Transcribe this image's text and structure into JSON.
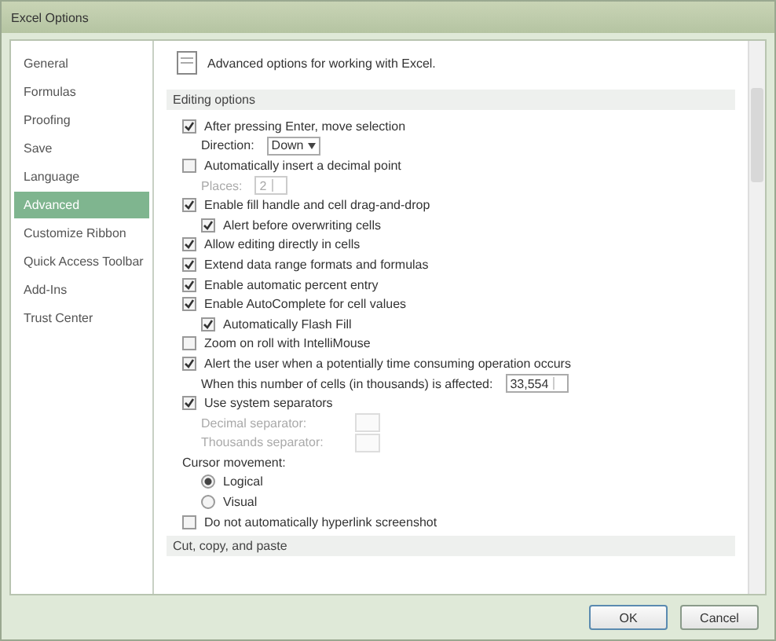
{
  "window": {
    "title": "Excel Options"
  },
  "sidebar": {
    "items": [
      {
        "label": "General",
        "selected": false
      },
      {
        "label": "Formulas",
        "selected": false
      },
      {
        "label": "Proofing",
        "selected": false
      },
      {
        "label": "Save",
        "selected": false
      },
      {
        "label": "Language",
        "selected": false
      },
      {
        "label": "Advanced",
        "selected": true
      },
      {
        "label": "Customize Ribbon",
        "selected": false
      },
      {
        "label": "Quick Access Toolbar",
        "selected": false
      },
      {
        "label": "Add-Ins",
        "selected": false
      },
      {
        "label": "Trust Center",
        "selected": false
      }
    ]
  },
  "header": {
    "text": "Advanced options for working with Excel."
  },
  "sections": [
    {
      "title": "Editing options",
      "rows": [
        {
          "kind": "checkbox",
          "label": "After pressing Enter, move selection",
          "checked": true,
          "indent": false
        },
        {
          "kind": "dropdown",
          "label": "Direction:",
          "value": "Down"
        },
        {
          "kind": "checkbox",
          "label": "Automatically insert a decimal point",
          "checked": false,
          "indent": false
        },
        {
          "kind": "spinner",
          "label": "Places:",
          "value": "2",
          "disabled": true
        },
        {
          "kind": "checkbox",
          "label": "Enable fill handle and cell drag-and-drop",
          "checked": true,
          "indent": false
        },
        {
          "kind": "checkbox",
          "label": "Alert before overwriting cells",
          "checked": true,
          "indent": true
        },
        {
          "kind": "checkbox",
          "label": "Allow editing directly in cells",
          "checked": true,
          "indent": false
        },
        {
          "kind": "checkbox",
          "label": "Extend data range formats and formulas",
          "checked": true,
          "indent": false
        },
        {
          "kind": "checkbox",
          "label": "Enable automatic percent entry",
          "checked": true,
          "indent": false
        },
        {
          "kind": "checkbox",
          "label": "Enable AutoComplete for cell values",
          "checked": true,
          "indent": false
        },
        {
          "kind": "checkbox",
          "label": "Automatically Flash Fill",
          "checked": true,
          "indent": true
        },
        {
          "kind": "checkbox",
          "label": "Zoom on roll with IntelliMouse",
          "checked": false,
          "indent": false
        },
        {
          "kind": "checkbox",
          "label": "Alert the user when a potentially time consuming operation occurs",
          "checked": true,
          "indent": false
        },
        {
          "kind": "spinner",
          "label": "When this number of cells (in thousands) is affected:",
          "value": "33,554",
          "disabled": false
        },
        {
          "kind": "checkbox",
          "label": "Use system separators",
          "checked": true,
          "indent": false
        },
        {
          "kind": "field",
          "label": "Decimal separator:",
          "disabled": true
        },
        {
          "kind": "field",
          "label": "Thousands separator:",
          "disabled": true
        },
        {
          "kind": "heading",
          "label": "Cursor movement:"
        },
        {
          "kind": "radio",
          "label": "Logical",
          "selected": true
        },
        {
          "kind": "radio",
          "label": "Visual",
          "selected": false
        },
        {
          "kind": "checkbox",
          "label": "Do not automatically hyperlink screenshot",
          "checked": false,
          "indent": false
        }
      ]
    },
    {
      "title": "Cut, copy, and paste"
    }
  ],
  "buttons": [
    "OK",
    "Cancel"
  ]
}
